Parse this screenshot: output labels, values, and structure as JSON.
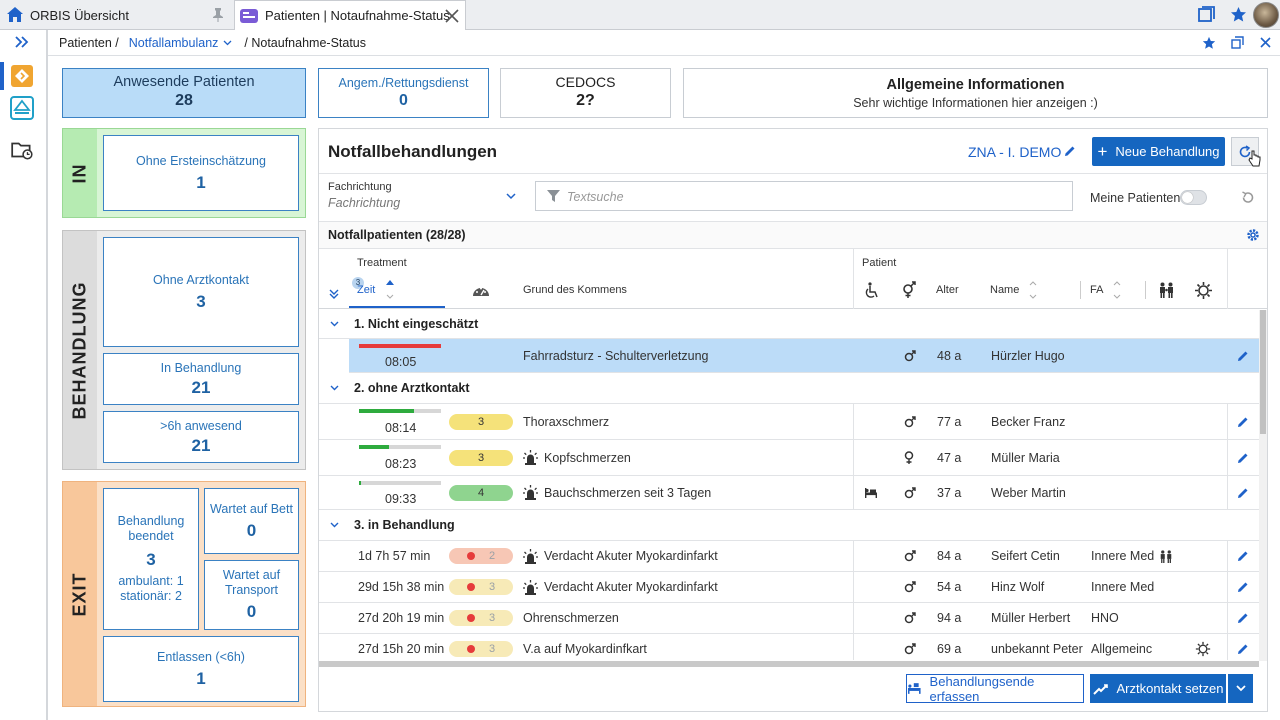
{
  "tabs": [
    {
      "label": "ORBIS Übersicht"
    },
    {
      "label": "Patienten | Notaufnahme-Status"
    }
  ],
  "breadcrumb": {
    "root": "Patienten /",
    "mid": "Notfallambulanz",
    "last": "/ Notaufnahme-Status"
  },
  "top_tiles": {
    "present": {
      "label": "Anwesende Patienten",
      "value": "28"
    },
    "announced": {
      "label": "Angem./Rettungsdienst",
      "value": "0"
    },
    "cedocs": {
      "label": "CEDOCS",
      "value": "2?"
    },
    "info": {
      "title": "Allgemeine Informationen",
      "text": "Sehr wichtige Informationen hier anzeigen :)"
    }
  },
  "in": {
    "label": "IN",
    "items": [
      {
        "label": "Ohne Ersteinschätzung",
        "value": "1"
      }
    ]
  },
  "behandlung": {
    "label": "BEHANDLUNG",
    "items": [
      {
        "label": "Ohne Arztkontakt",
        "value": "3"
      },
      {
        "label": "In Behandlung",
        "value": "21"
      },
      {
        "label": ">6h anwesend",
        "value": "21"
      }
    ]
  },
  "exit": {
    "label": "EXIT",
    "finished": {
      "label": "Behandlung beendet",
      "value": "3",
      "detail1": "ambulant: 1",
      "detail2": "stationär: 2"
    },
    "bed": {
      "label": "Wartet auf Bett",
      "value": "0"
    },
    "transport": {
      "label": "Wartet auf Transport",
      "value": "0"
    },
    "released": {
      "label": "Entlassen (<6h)",
      "value": "1"
    }
  },
  "panel": {
    "title": "Notfallbehandlungen",
    "unit": "ZNA - I. DEMO",
    "new_button": "Neue Behandlung",
    "filter_label": "Fachrichtung",
    "filter_placeholder": "Fachrichtung",
    "search_placeholder": "Textsuche",
    "my_patients": "Meine Patienten",
    "list_title": "Notfallpatienten (28/28)",
    "hdr_treatment": "Treatment",
    "hdr_patient": "Patient",
    "hdr_time": "Zeit",
    "hdr_sort_badge": "3",
    "hdr_reason": "Grund des Kommens",
    "hdr_age": "Alter",
    "hdr_name": "Name",
    "hdr_fa": "FA",
    "btn_end": "Behandlungsende erfassen",
    "btn_contact": "Arztkontakt setzen"
  },
  "groups": [
    {
      "label": "1. Nicht eingeschätzt",
      "rows": [
        {
          "time": "08:05",
          "prio": "",
          "prio_color": "",
          "bar_color": "#e63b3b",
          "bar_pct": 1.0,
          "siren": false,
          "reason": "Fahrradsturz - Schulterverletzung",
          "bed": false,
          "sex": "m",
          "age": "48 a",
          "name": "Hürzler Hugo",
          "fa": "",
          "selected": true,
          "sun": false,
          "people": false
        }
      ]
    },
    {
      "label": "2. ohne Arztkontakt",
      "rows": [
        {
          "time": "08:14",
          "prio": "3",
          "prio_color": "#f5e27a",
          "bar_color": "#2eab3e",
          "bar_pct": 0.67,
          "siren": false,
          "reason": "Thoraxschmerz",
          "bed": false,
          "sex": "m",
          "age": "77 a",
          "name": "Becker Franz",
          "fa": "",
          "selected": false,
          "sun": false,
          "people": false
        },
        {
          "time": "08:23",
          "prio": "3",
          "prio_color": "#f5e27a",
          "bar_color": "#2eab3e",
          "bar_pct": 0.36,
          "siren": true,
          "reason": "Kopfschmerzen",
          "bed": false,
          "sex": "f",
          "age": "47 a",
          "name": "Müller Maria",
          "fa": "",
          "selected": false,
          "sun": false,
          "people": false
        },
        {
          "time": "09:33",
          "prio": "4",
          "prio_color": "#8fd48f",
          "bar_color": "#2eab3e",
          "bar_pct": 0.02,
          "siren": true,
          "reason": "Bauchschmerzen seit 3 Tagen",
          "bed": true,
          "sex": "m",
          "age": "37 a",
          "name": "Weber Martin",
          "fa": "",
          "selected": false,
          "sun": false,
          "people": false
        }
      ]
    },
    {
      "label": "3. in Behandlung",
      "rows": [
        {
          "time": "1d 7h 57 min",
          "prio": "2",
          "prio_color": "#f7c7b5",
          "dot": true,
          "siren": true,
          "reason": "Verdacht Akuter Myokardinfarkt",
          "bed": false,
          "sex": "m",
          "age": "84 a",
          "name": "Seifert Cetin",
          "fa": "Innere Med",
          "selected": false,
          "sun": false,
          "people": true
        },
        {
          "time": "29d 15h 38 min",
          "prio": "3",
          "prio_color": "#f7eab7",
          "dot": true,
          "siren": true,
          "reason": "Verdacht Akuter Myokardinfarkt",
          "bed": false,
          "sex": "m",
          "age": "54 a",
          "name": "Hinz Wolf",
          "fa": "Innere Med",
          "selected": false,
          "sun": false,
          "people": false
        },
        {
          "time": "27d 20h 19 min",
          "prio": "3",
          "prio_color": "#f7eab7",
          "dot": true,
          "siren": false,
          "reason": "Ohrenschmerzen",
          "bed": false,
          "sex": "m",
          "age": "94 a",
          "name": "Müller Herbert",
          "fa": "HNO",
          "selected": false,
          "sun": false,
          "people": false
        },
        {
          "time": "27d 15h 20 min",
          "prio": "3",
          "prio_color": "#f7eab7",
          "dot": true,
          "siren": false,
          "reason": "V.a auf Myokardinfkart",
          "bed": false,
          "sex": "m",
          "age": "69 a",
          "name": "unbekannt Peter",
          "fa": "Allgemeinc",
          "selected": false,
          "sun": true,
          "people": false
        }
      ]
    }
  ]
}
